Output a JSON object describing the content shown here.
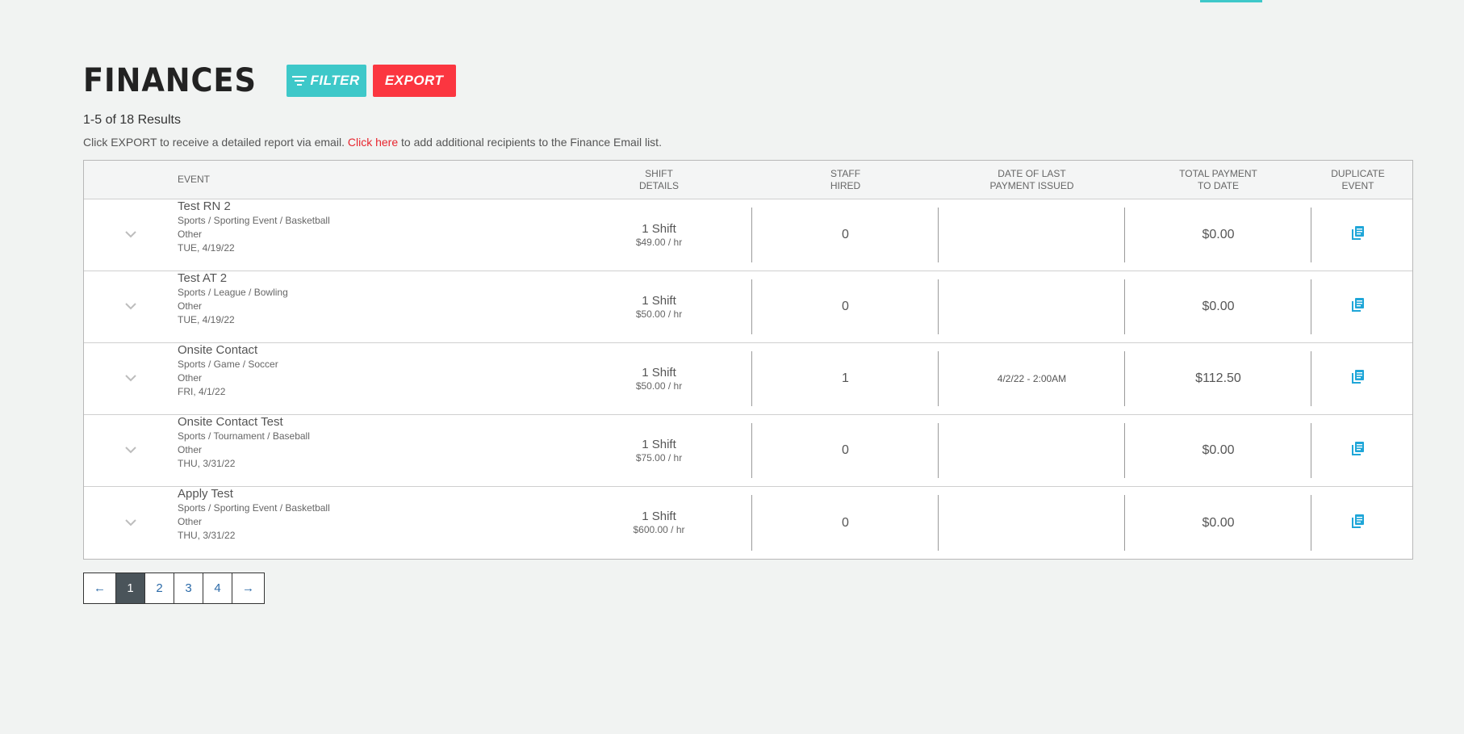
{
  "header": {
    "title": "FINANCES",
    "filter_label": "FILTER",
    "export_label": "EXPORT"
  },
  "results_text": "1-5 of 18 Results",
  "info": {
    "before": "Click EXPORT to receive a detailed report via email. ",
    "link": "Click here",
    "after": " to add additional recipients to the Finance Email list."
  },
  "table": {
    "columns": {
      "event": "EVENT",
      "shift_line1": "SHIFT",
      "shift_line2": "DETAILS",
      "staff_line1": "STAFF",
      "staff_line2": "HIRED",
      "date_line1": "DATE OF LAST",
      "date_line2": "PAYMENT ISSUED",
      "total_line1": "TOTAL PAYMENT",
      "total_line2": "TO DATE",
      "dup_line1": "DUPLICATE",
      "dup_line2": "EVENT"
    },
    "rows": [
      {
        "name": "Test RN 2",
        "category": "Sports / Sporting Event / Basketball",
        "type": "Other",
        "date": "TUE, 4/19/22",
        "shifts": "1 Shift",
        "rate": "$49.00 / hr",
        "staff": "0",
        "last_payment": "",
        "total": "$0.00"
      },
      {
        "name": "Test AT 2",
        "category": "Sports / League / Bowling",
        "type": "Other",
        "date": "TUE, 4/19/22",
        "shifts": "1 Shift",
        "rate": "$50.00 / hr",
        "staff": "0",
        "last_payment": "",
        "total": "$0.00"
      },
      {
        "name": "Onsite Contact",
        "category": "Sports / Game / Soccer",
        "type": "Other",
        "date": "FRI, 4/1/22",
        "shifts": "1 Shift",
        "rate": "$50.00 / hr",
        "staff": "1",
        "last_payment": "4/2/22 - 2:00AM",
        "total": "$112.50"
      },
      {
        "name": "Onsite Contact Test",
        "category": "Sports / Tournament / Baseball",
        "type": "Other",
        "date": "THU, 3/31/22",
        "shifts": "1 Shift",
        "rate": "$75.00 / hr",
        "staff": "0",
        "last_payment": "",
        "total": "$0.00"
      },
      {
        "name": "Apply Test",
        "category": "Sports / Sporting Event / Basketball",
        "type": "Other",
        "date": "THU, 3/31/22",
        "shifts": "1 Shift",
        "rate": "$600.00 / hr",
        "staff": "0",
        "last_payment": "",
        "total": "$0.00"
      }
    ]
  },
  "pagination": {
    "prev": "←",
    "pages": [
      "1",
      "2",
      "3",
      "4"
    ],
    "active": "1",
    "next": "→"
  },
  "colors": {
    "accent": "#3ec8c9",
    "export": "#fb3640",
    "link": "#e8262f",
    "dup_icon": "#1fa6d8"
  },
  "icons": {
    "toggle": "chevron-down-icon",
    "duplicate": "copy-icon",
    "filter": "filter-icon"
  }
}
